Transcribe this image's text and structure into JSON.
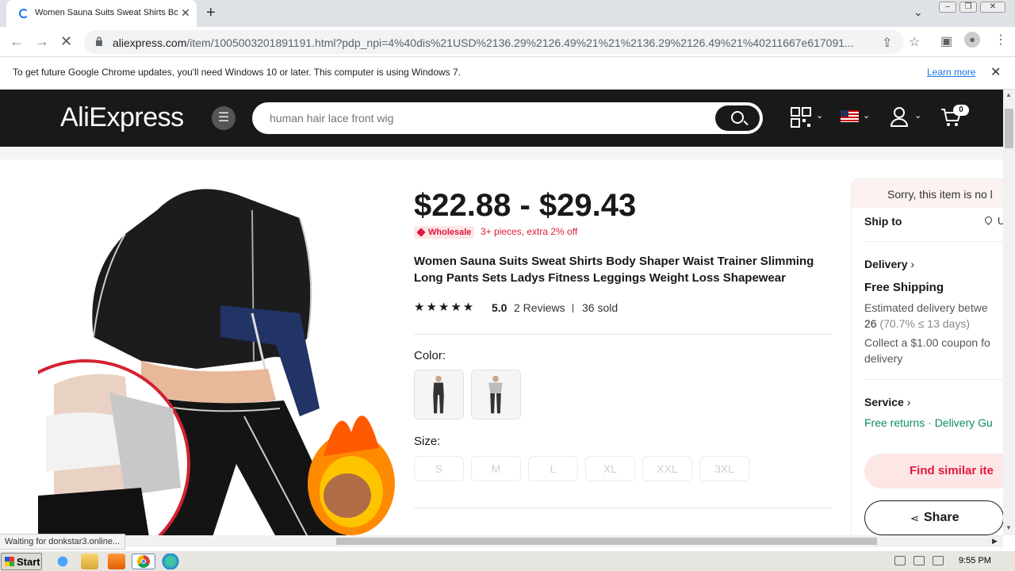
{
  "browser": {
    "tab_title": "Women Sauna Suits Sweat Shirts Bo",
    "url_host": "aliexpress.com",
    "url_path": "/item/1005003201891191.html?pdp_npi=4%40dis%21USD%2136.29%2126.49%21%21%2136.29%2126.49%21%40211667e617091...",
    "infobar_text": "To get future Google Chrome updates, you'll need Windows 10 or later. This computer is using Windows 7.",
    "infobar_link": "Learn more"
  },
  "header": {
    "logo": "AliExpress",
    "search_placeholder": "human hair lace front wig",
    "cart_count": "0"
  },
  "product": {
    "price": "$22.88 - $29.43",
    "wholesale_badge": "Wholesale",
    "wholesale_text": "3+ pieces, extra 2% off",
    "title": "Women Sauna Suits Sweat Shirts Body Shaper Waist Trainer Slimming Long Pants Sets Ladys Fitness Leggings Weight Loss Shapewear",
    "stars": "★★★★★",
    "rating": "5.0",
    "reviews": "2 Reviews",
    "sold": "36 sold",
    "color_label": "Color:",
    "size_label": "Size:",
    "sizes": [
      "S",
      "M",
      "L",
      "XL",
      "XXL",
      "3XL"
    ]
  },
  "panel": {
    "sorry": "Sorry, this item is no l",
    "ship_to": "Ship to",
    "ship_to_value": "U",
    "delivery": "Delivery",
    "free_shipping": "Free Shipping",
    "est_delivery_1": "Estimated delivery betwe",
    "est_delivery_2a": "26",
    "est_delivery_2b": "(70.7% ≤ 13 days)",
    "coupon_1": "Collect a $1.00 coupon fo",
    "coupon_2": "delivery",
    "service": "Service",
    "service_items": "Free returns · Delivery Gu",
    "find_similar": "Find similar ite",
    "share": "Share"
  },
  "status": {
    "text": "Waiting for donkstar3.online..."
  },
  "taskbar": {
    "start": "Start",
    "clock": "9:55 PM"
  },
  "colors": {
    "accent_red": "#e0193d",
    "header_black": "#191919",
    "service_green": "#0b8d5e"
  }
}
